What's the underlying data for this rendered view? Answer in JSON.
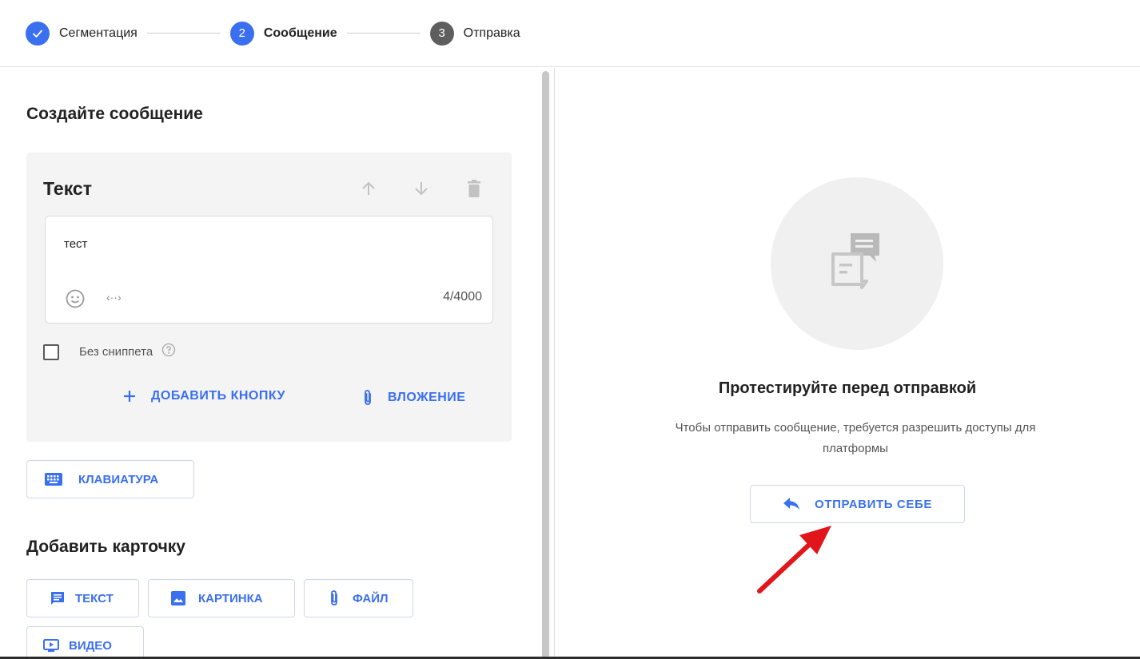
{
  "stepper": {
    "steps": [
      {
        "number": "",
        "label": "Сегментация",
        "state": "done"
      },
      {
        "number": "2",
        "label": "Сообщение",
        "state": "active"
      },
      {
        "number": "3",
        "label": "Отправка",
        "state": "pending"
      }
    ]
  },
  "left": {
    "title": "Создайте сообщение",
    "card": {
      "title": "Текст",
      "text_value": "тест",
      "char_count": "4/4000",
      "variable_icon_text": "‹··›",
      "snippet_label": "Без сниппета",
      "snippet_checked": false,
      "add_button_label": "ДОБАВИТЬ КНОПКУ",
      "attachment_label": "ВЛОЖЕНИЕ"
    },
    "keyboard_label": "КЛАВИАТУРА",
    "add_card_title": "Добавить карточку",
    "card_types": {
      "text": "ТЕКСТ",
      "image": "КАРТИНКА",
      "file": "ФАЙЛ",
      "video": "ВИДЕО"
    }
  },
  "right": {
    "title": "Протестируйте перед отправкой",
    "description": "Чтобы отправить сообщение, требуется разрешить доступы для платформы",
    "send_self_label": "ОТПРАВИТЬ СЕБЕ"
  },
  "colors": {
    "accent": "#3a6ff0",
    "pending_step": "#5e5e5e",
    "annotation_arrow": "#e0161c"
  },
  "icons": [
    "check-icon",
    "arrow-up-icon",
    "arrow-down-icon",
    "trash-icon",
    "emoji-icon",
    "variable-icon",
    "help-icon",
    "plus-icon",
    "paperclip-icon",
    "keyboard-icon",
    "message-icon",
    "image-icon",
    "video-icon",
    "reply-icon",
    "chat-illustration-icon"
  ]
}
